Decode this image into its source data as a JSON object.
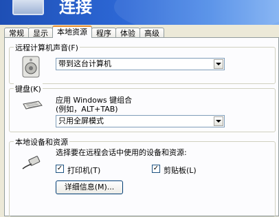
{
  "window": {
    "title": "连接"
  },
  "tabs": [
    {
      "label": "常规"
    },
    {
      "label": "显示"
    },
    {
      "label": "本地资源"
    },
    {
      "label": "程序"
    },
    {
      "label": "体验"
    },
    {
      "label": "高级"
    }
  ],
  "active_tab": "本地资源",
  "sound": {
    "group_label": "远程计算机声音(F)",
    "selected": "带到这台计算机"
  },
  "keyboard": {
    "group_label": "键盘(K)",
    "description_line1": "应用 Windows 键组合",
    "description_line2": "(例如，ALT+TAB)",
    "selected": "只用全屏模式"
  },
  "local_devices": {
    "group_label": "本地设备和资源",
    "description": "选择要在远程会话中使用的设备和资源:",
    "printers_label": "打印机(T)",
    "printers_checked": true,
    "clipboard_label": "剪贴板(L)",
    "clipboard_checked": true,
    "details_button": "详细信息(M)...",
    "checkmark": "✓"
  }
}
